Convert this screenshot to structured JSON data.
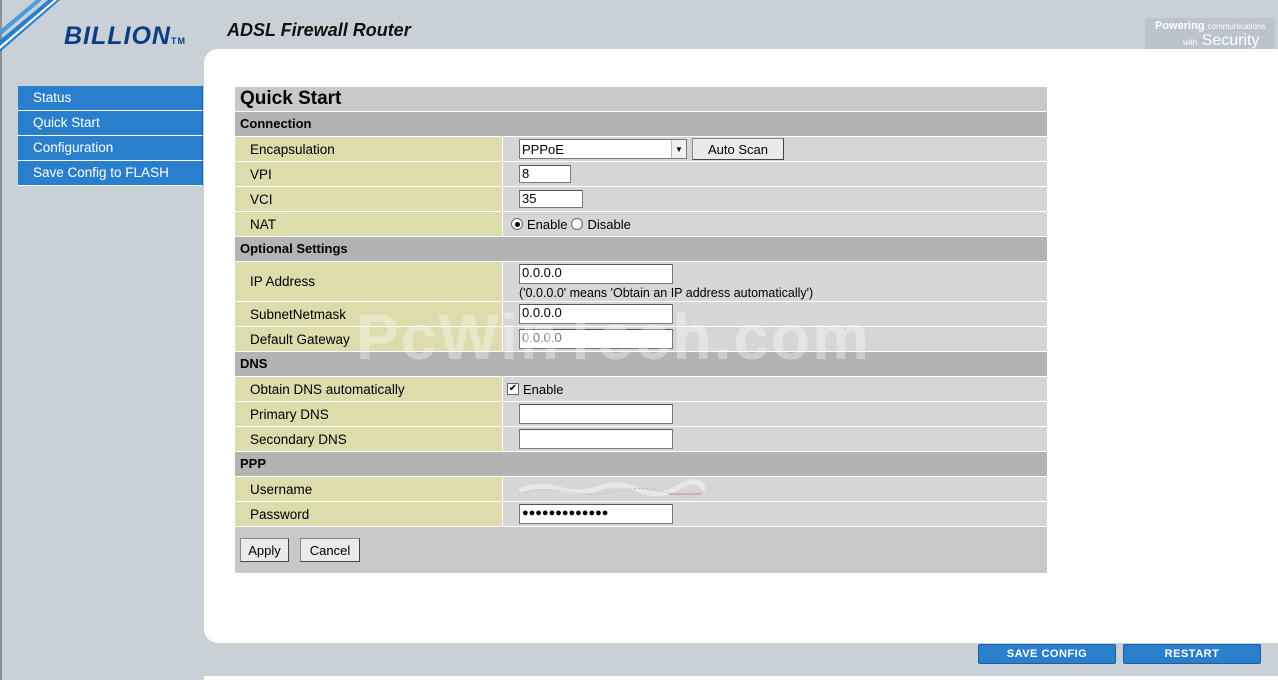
{
  "header": {
    "logo_text": "BILLION",
    "logo_tm": "TM",
    "app_title": "ADSL Firewall Router",
    "tagline_powering": "Powering",
    "tagline_communications": "communications",
    "tagline_with": "with",
    "tagline_security": "Security"
  },
  "sidebar": {
    "items": [
      {
        "label": "Status"
      },
      {
        "label": "Quick Start"
      },
      {
        "label": "Configuration"
      },
      {
        "label": "Save Config to FLASH"
      }
    ]
  },
  "form": {
    "title": "Quick Start",
    "sections": {
      "connection": "Connection",
      "optional": "Optional Settings",
      "dns": "DNS",
      "ppp": "PPP"
    },
    "fields": {
      "encapsulation": {
        "label": "Encapsulation",
        "value": "PPPoE"
      },
      "auto_scan": "Auto Scan",
      "vpi": {
        "label": "VPI",
        "value": "8"
      },
      "vci": {
        "label": "VCI",
        "value": "35"
      },
      "nat": {
        "label": "NAT",
        "enable": "Enable",
        "disable": "Disable",
        "selected": "Enable"
      },
      "ip_address": {
        "label": "IP Address",
        "value": "0.0.0.0",
        "hint": "('0.0.0.0' means 'Obtain an IP address automatically')"
      },
      "subnet": {
        "label": "SubnetNetmask",
        "value": "0.0.0.0"
      },
      "gateway": {
        "label": "Default Gateway",
        "value": "0.0.0.0"
      },
      "obtain_dns": {
        "label": "Obtain DNS automatically",
        "option": "Enable",
        "checked": true
      },
      "primary_dns": {
        "label": "Primary DNS",
        "value": ""
      },
      "secondary_dns": {
        "label": "Secondary DNS",
        "value": ""
      },
      "username": {
        "label": "Username"
      },
      "password": {
        "label": "Password",
        "value": "●●●●●●●●●●●●●"
      }
    },
    "apply": "Apply",
    "cancel": "Cancel"
  },
  "footer": {
    "save_config": "SAVE CONFIG",
    "restart": "RESTART"
  },
  "watermark": "PcWinTech.com",
  "colors": {
    "nav_blue": "#2a7fcc",
    "label_cell": "#dcdcac",
    "section_header": "#b3b3b3",
    "frame": "#c9d0d6"
  }
}
